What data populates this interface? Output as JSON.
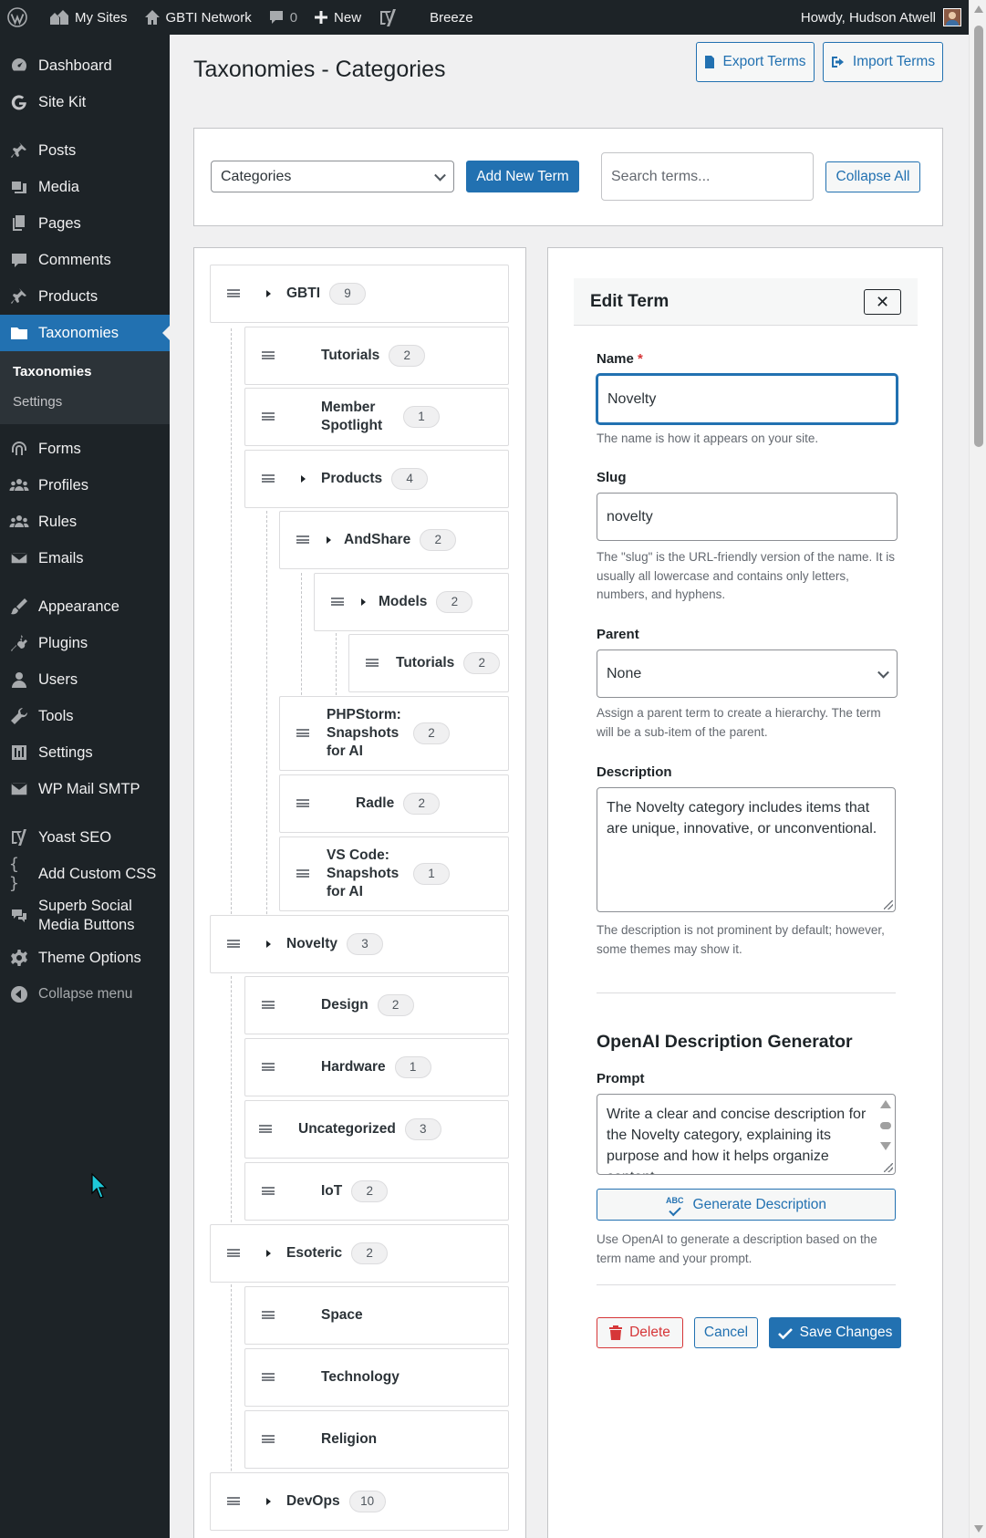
{
  "adminbar": {
    "my_sites": "My Sites",
    "network": "GBTI Network",
    "comments_count": "0",
    "new": "New",
    "breeze": "Breeze",
    "howdy": "Howdy, Hudson Atwell"
  },
  "sidebar": {
    "items": [
      {
        "label": "Dashboard",
        "icon": "dashboard-icon"
      },
      {
        "label": "Site Kit",
        "icon": "google-g-icon"
      },
      {
        "label": "Posts",
        "icon": "pin-icon"
      },
      {
        "label": "Media",
        "icon": "media-icon"
      },
      {
        "label": "Pages",
        "icon": "pages-icon"
      },
      {
        "label": "Comments",
        "icon": "comment-icon"
      },
      {
        "label": "Products",
        "icon": "pin-icon"
      },
      {
        "label": "Taxonomies",
        "icon": "folder-icon"
      },
      {
        "label": "Forms",
        "icon": "fingerprint-icon"
      },
      {
        "label": "Profiles",
        "icon": "groups-icon"
      },
      {
        "label": "Rules",
        "icon": "groups-icon"
      },
      {
        "label": "Emails",
        "icon": "email-icon"
      },
      {
        "label": "Appearance",
        "icon": "brush-icon"
      },
      {
        "label": "Plugins",
        "icon": "plug-icon"
      },
      {
        "label": "Users",
        "icon": "user-icon"
      },
      {
        "label": "Tools",
        "icon": "wrench-icon"
      },
      {
        "label": "Settings",
        "icon": "sliders-icon"
      },
      {
        "label": "WP Mail SMTP",
        "icon": "mail-icon"
      },
      {
        "label": "Yoast SEO",
        "icon": "yoast-icon"
      },
      {
        "label": "Add Custom CSS",
        "icon": "braces-icon"
      },
      {
        "label": "Superb Social Media Buttons",
        "icon": "share-icon"
      },
      {
        "label": "Theme Options",
        "icon": "gear-icon"
      }
    ],
    "submenu": [
      "Taxonomies",
      "Settings"
    ],
    "collapse": "Collapse menu"
  },
  "page": {
    "title": "Taxonomies - Categories",
    "export": "Export Terms",
    "import": "Import Terms"
  },
  "toolbar": {
    "taxonomy_select": "Categories",
    "add_new": "Add New Term",
    "search_placeholder": "Search terms...",
    "collapse_all": "Collapse All"
  },
  "tree": [
    {
      "label": "GBTI",
      "count": "9"
    },
    {
      "label": "Tutorials",
      "count": "2"
    },
    {
      "label": "Member Spotlight",
      "count": "1"
    },
    {
      "label": "Products",
      "count": "4"
    },
    {
      "label": "AndShare",
      "count": "2"
    },
    {
      "label": "Models",
      "count": "2"
    },
    {
      "label": "Tutorials",
      "count": "2"
    },
    {
      "label": "PHPStorm: Snapshots for AI",
      "count": "2"
    },
    {
      "label": "Radle",
      "count": "2"
    },
    {
      "label": "VS Code: Snapshots for AI",
      "count": "1"
    },
    {
      "label": "Novelty",
      "count": "3"
    },
    {
      "label": "Design",
      "count": "2"
    },
    {
      "label": "Hardware",
      "count": "1"
    },
    {
      "label": "Uncategorized",
      "count": "3"
    },
    {
      "label": "IoT",
      "count": "2"
    },
    {
      "label": "Esoteric",
      "count": "2"
    },
    {
      "label": "Space",
      "count": ""
    },
    {
      "label": "Technology",
      "count": ""
    },
    {
      "label": "Religion",
      "count": ""
    },
    {
      "label": "DevOps",
      "count": "10"
    }
  ],
  "edit": {
    "title": "Edit Term",
    "close": "✕",
    "name_label": "Name",
    "required_mark": "*",
    "name_value": "Novelty",
    "name_help": "The name is how it appears on your site.",
    "slug_label": "Slug",
    "slug_value": "novelty",
    "slug_help": "The \"slug\" is the URL-friendly version of the name. It is usually all lowercase and contains only letters, numbers, and hyphens.",
    "parent_label": "Parent",
    "parent_value": "None",
    "parent_help": "Assign a parent term to create a hierarchy. The term will be a sub-item of the parent.",
    "description_label": "Description",
    "description_value": "The Novelty category includes items that are unique, innovative, or unconventional.",
    "description_help": "The description is not prominent by default; however, some themes may show it.",
    "openai_title": "OpenAI Description Generator",
    "prompt_label": "Prompt",
    "prompt_value": "Write a clear and concise description for the Novelty category, explaining its purpose and how it helps organize content.",
    "abc": "ABC",
    "generate": "Generate Description",
    "generate_help": "Use OpenAI to generate a description based on the term name and your prompt.",
    "delete": "Delete",
    "cancel": "Cancel",
    "save": "Save Changes"
  },
  "colors": {
    "admin_dark": "#1d2327",
    "accent": "#2271b1",
    "danger": "#d63638"
  }
}
